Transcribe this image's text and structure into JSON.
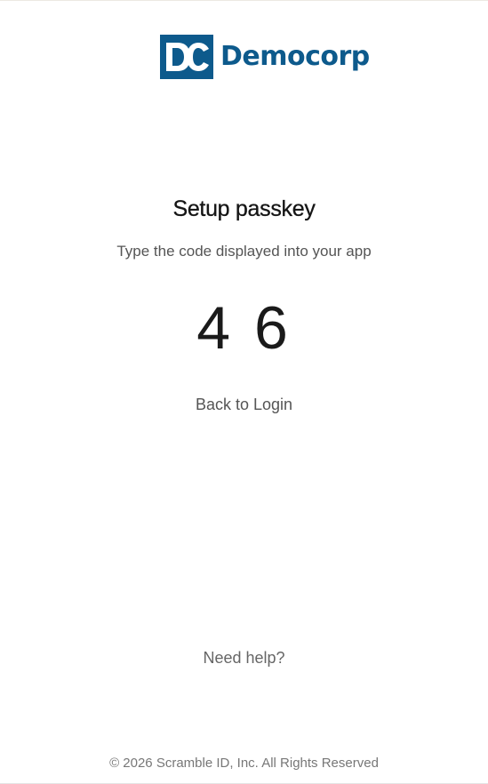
{
  "brand": {
    "logo_text": "Democorp",
    "mark_letters": "DC",
    "color": "#0d5a8c"
  },
  "main": {
    "title": "Setup passkey",
    "instruction": "Type the code displayed into your app",
    "code": "4 6",
    "back_link": "Back to Login"
  },
  "help": {
    "link": "Need help?"
  },
  "footer": {
    "copyright": "© 2026 Scramble ID, Inc. All Rights Reserved"
  }
}
